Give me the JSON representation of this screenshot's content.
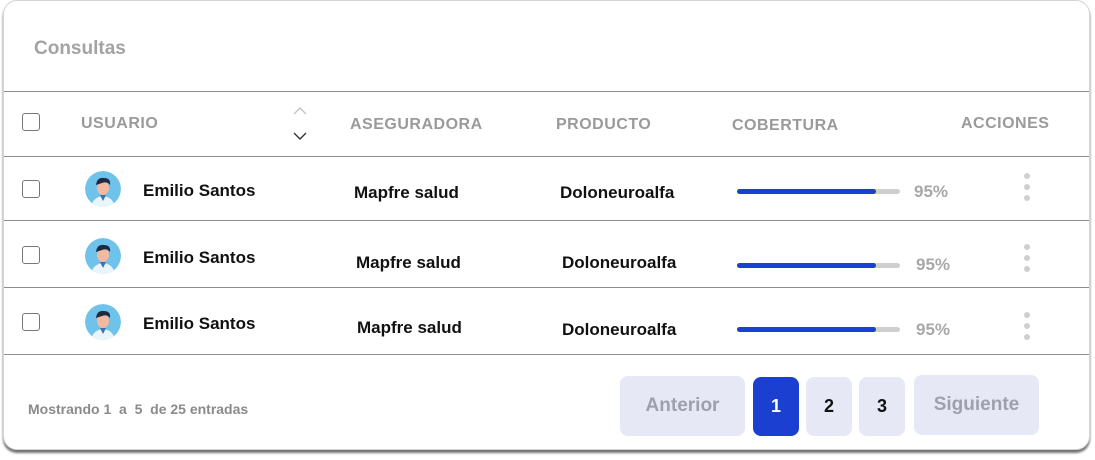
{
  "title": "Consultas",
  "columns": {
    "usuario": "USUARIO",
    "aseguradora": "ASEGURADORA",
    "producto": "PRODUCTO",
    "cobertura": "COBERTURA",
    "acciones": "ACCIONES"
  },
  "rows": [
    {
      "name": "Emilio Santos",
      "aseguradora": "Mapfre salud",
      "producto": "Doloneuroalfa",
      "cobertura_label": "95%",
      "cobertura_fraction": 0.85
    },
    {
      "name": "Emilio Santos",
      "aseguradora": "Mapfre salud",
      "producto": "Doloneuroalfa",
      "cobertura_label": "95%",
      "cobertura_fraction": 0.85
    },
    {
      "name": "Emilio Santos",
      "aseguradora": "Mapfre salud",
      "producto": "Doloneuroalfa",
      "cobertura_label": "95%",
      "cobertura_fraction": 0.85
    }
  ],
  "footer": {
    "showing": "Mostrando 1  a  5  de 25 entradas"
  },
  "pagination": {
    "prev": "Anterior",
    "pages": [
      "1",
      "2",
      "3"
    ],
    "current": "1",
    "next": "Siguiente"
  },
  "colors": {
    "accent": "#1a3fd1",
    "muted_button": "#e6e9f5"
  }
}
